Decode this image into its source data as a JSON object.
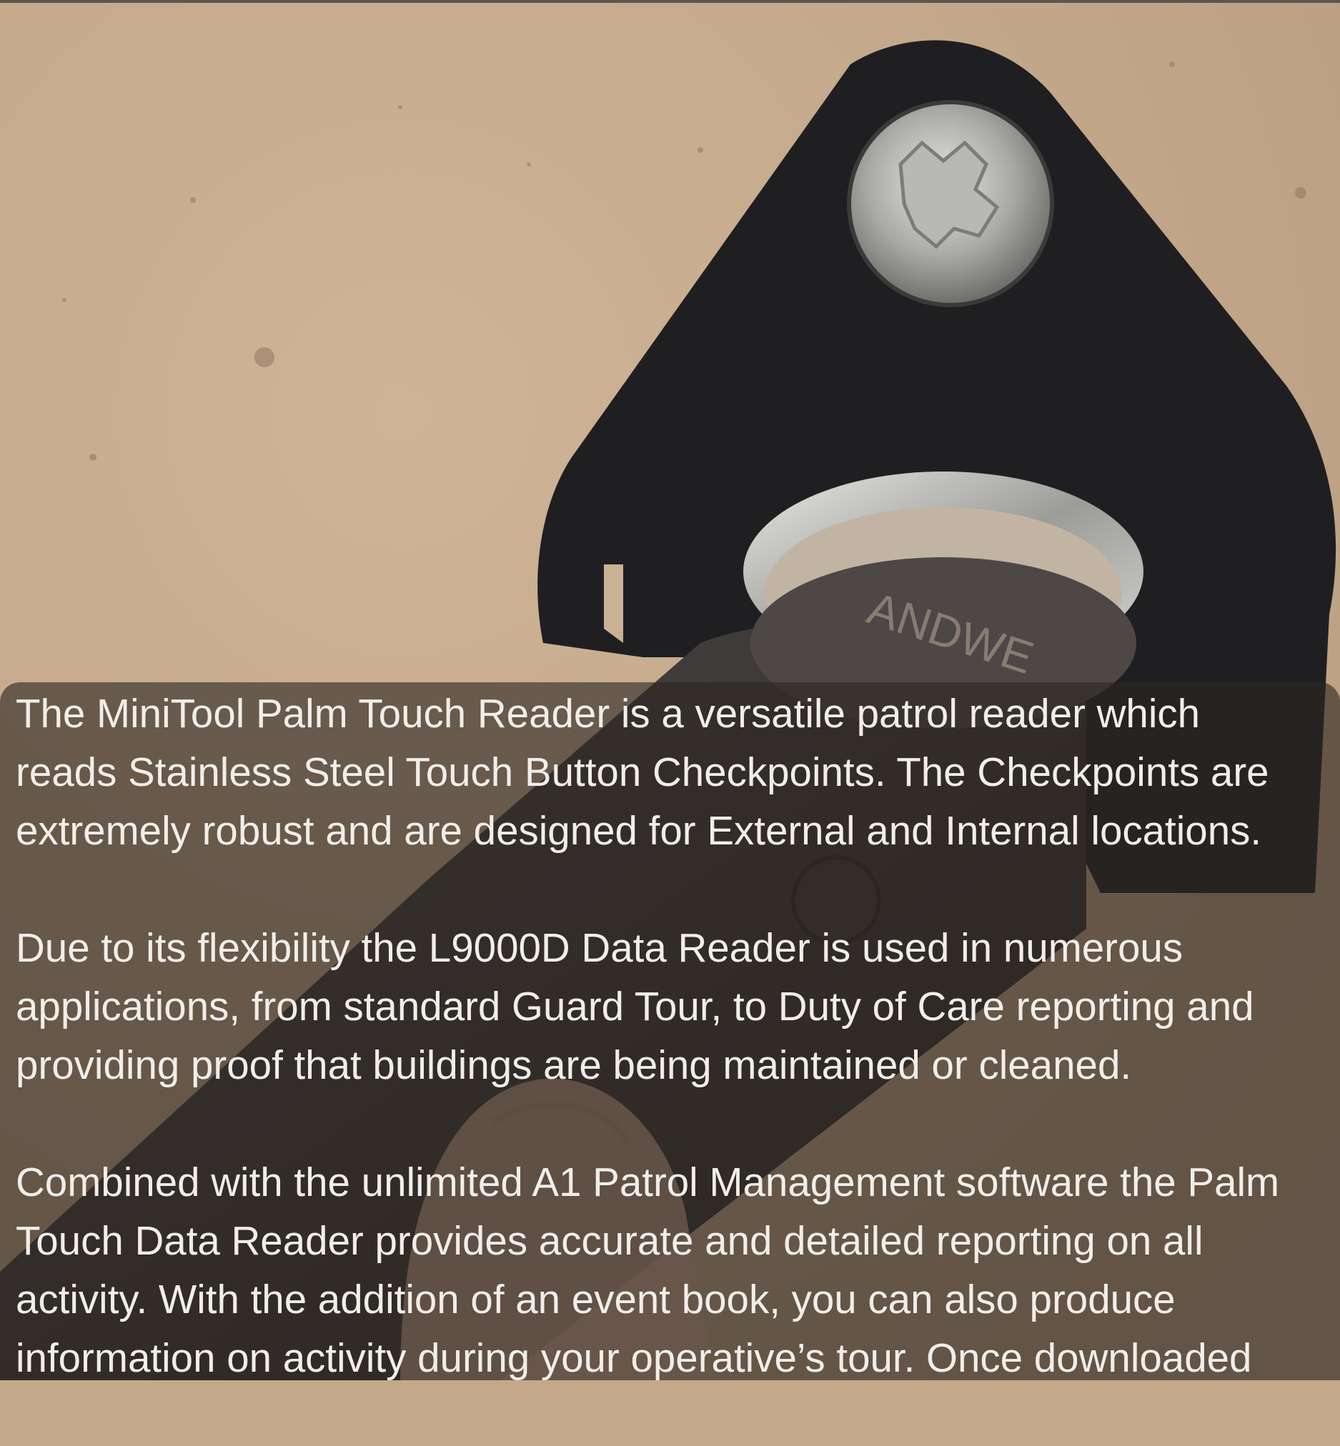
{
  "paragraphs": [
    "The MiniTool Palm Touch Reader is a versatile patrol reader which\nreads Stainless Steel Touch Button Checkpoints. The Checkpoints are\nextremely robust and are designed for External and Internal locations.",
    "Due to its flexibility the L9000D Data Reader is used in numerous\napplications, from standard Guard Tour, to Duty of Care reporting and\nproviding proof that buildings are being maintained or cleaned.",
    "Combined with the unlimited A1 Patrol Management software the Palm\nTouch Data Reader provides accurate and detailed reporting on all\nactivity. With the addition of an event book, you can also produce\ninformation on activity during your operative’s tour. Once downloaded"
  ],
  "device_engraving": "ANDWE",
  "colors": {
    "background": "#c4a88a",
    "bracket": "#1e1e20",
    "overlay": "rgba(45,38,34,0.62)",
    "text": "#f1eeea"
  }
}
